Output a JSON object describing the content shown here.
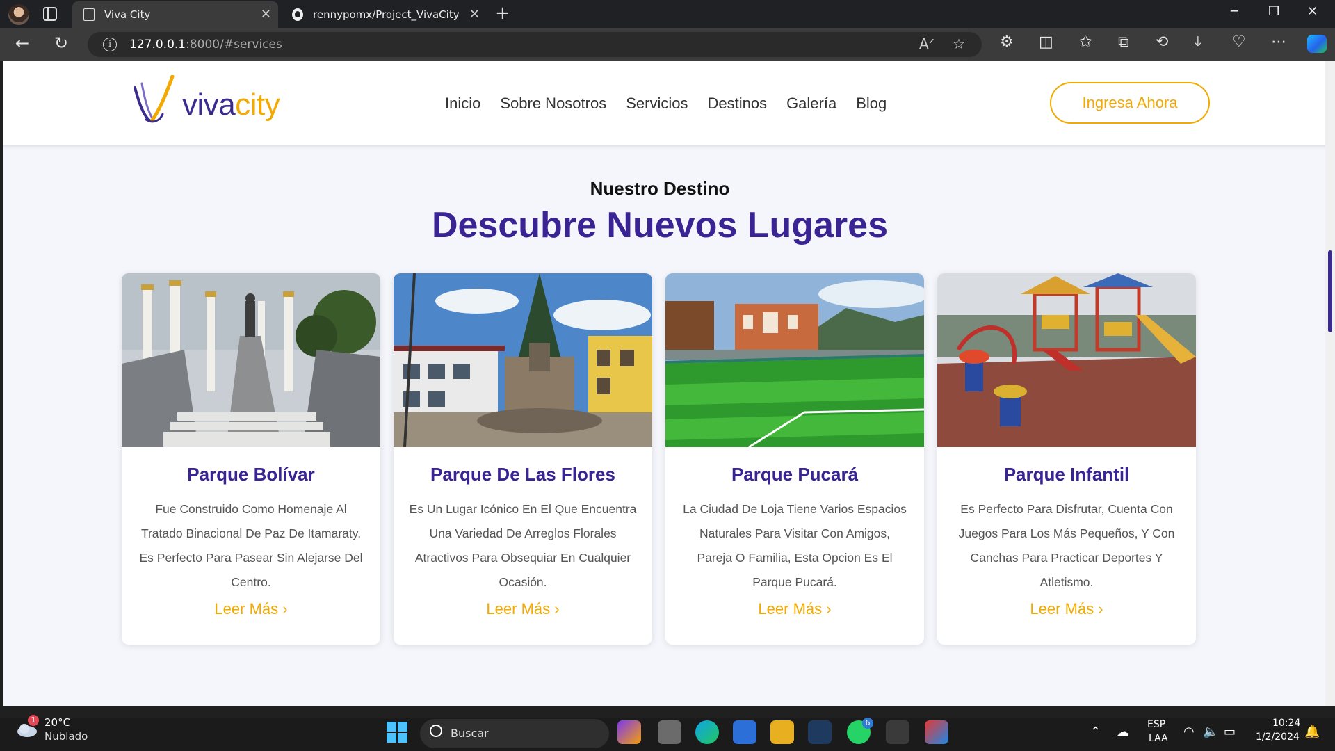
{
  "browser": {
    "tabs": [
      {
        "title": "Viva City",
        "active": true,
        "icon": "page-icon"
      },
      {
        "title": "rennypomx/Project_VivaCity",
        "active": false,
        "icon": "github-icon"
      }
    ],
    "address_host": "127.0.0.1",
    "address_rest": ":8000/#services"
  },
  "site": {
    "logo": {
      "viva": "viva",
      "city": "city"
    },
    "nav": [
      "Inicio",
      "Sobre Nosotros",
      "Servicios",
      "Destinos",
      "Galería",
      "Blog"
    ],
    "cta": "Ingresa Ahora",
    "section": {
      "eyebrow": "Nuestro Destino",
      "title": "Descubre Nuevos Lugares"
    },
    "cards": [
      {
        "title": "Parque Bolívar",
        "desc": "Fue Construido Como Homenaje Al Tratado Binacional De Paz De Itamaraty. Es Perfecto Para Pasear Sin Alejarse Del Centro.",
        "link": "Leer Más ›",
        "scene": "monument"
      },
      {
        "title": "Parque De Las Flores",
        "desc": "Es Un Lugar Icónico En El Que Encuentra Una Variedad De Arreglos Florales Atractivos Para Obsequiar En Cualquier Ocasión.",
        "link": "Leer Más ›",
        "scene": "plaza"
      },
      {
        "title": "Parque Pucará",
        "desc": "La Ciudad De Loja Tiene Varios Espacios Naturales Para Visitar Con Amigos, Pareja O Familia, Esta Opcion Es El Parque Pucará.",
        "link": "Leer Más ›",
        "scene": "football-field"
      },
      {
        "title": "Parque Infantil",
        "desc": "Es Perfecto Para Disfrutar, Cuenta Con Juegos Para Los Más Pequeños, Y Con Canchas Para Practicar Deportes Y Atletismo.",
        "link": "Leer Más ›",
        "scene": "playground"
      }
    ],
    "colors": {
      "primary": "#3a2393",
      "accent": "#f2a900"
    }
  },
  "taskbar": {
    "weather": {
      "badge": "1",
      "temp": "20°C",
      "condition": "Nublado"
    },
    "search_label": "Buscar",
    "whatsapp_badge": "6",
    "language": {
      "lang": "ESP",
      "layout": "LAA"
    },
    "clock": {
      "time": "10:24",
      "date": "1/2/2024"
    }
  }
}
